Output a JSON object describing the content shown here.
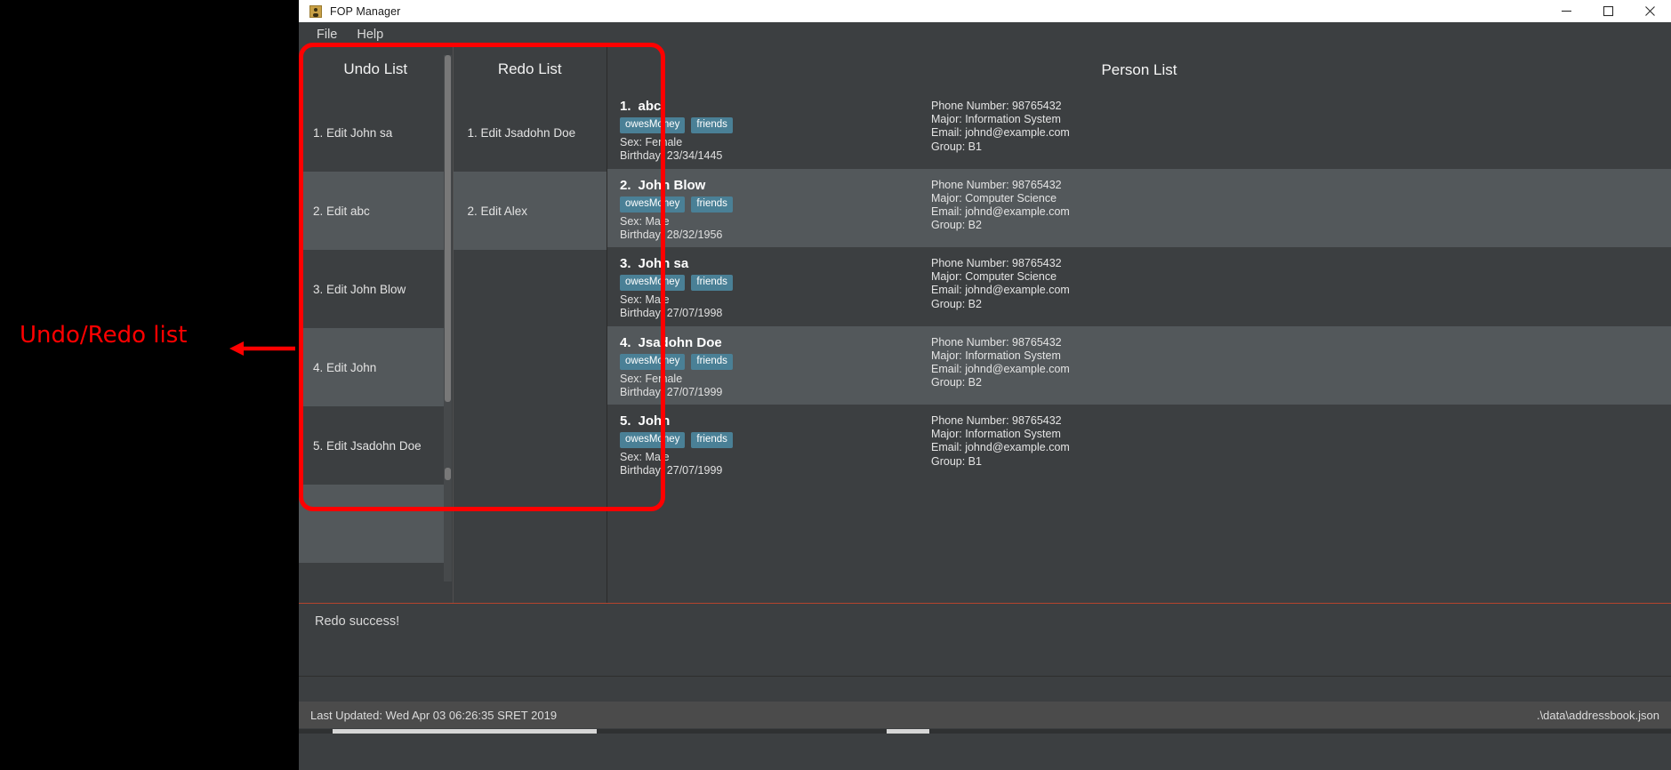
{
  "window": {
    "title": "FOP Manager",
    "icon": "app-person-icon",
    "controls": [
      {
        "name": "minimize",
        "glyph": "minimize-icon"
      },
      {
        "name": "maximize",
        "glyph": "maximize-icon"
      },
      {
        "name": "close",
        "glyph": "close-icon"
      }
    ]
  },
  "menubar": {
    "items": [
      {
        "label": "File"
      },
      {
        "label": "Help"
      }
    ]
  },
  "undo_list": {
    "title": "Undo List",
    "items": [
      {
        "label": "1. Edit John sa"
      },
      {
        "label": "2. Edit abc"
      },
      {
        "label": "3. Edit John Blow"
      },
      {
        "label": "4. Edit John"
      },
      {
        "label": "5. Edit Jsadohn Doe"
      },
      {
        "label": ""
      }
    ]
  },
  "redo_list": {
    "title": "Redo List",
    "items": [
      {
        "label": "1. Edit Jsadohn Doe"
      },
      {
        "label": "2. Edit Alex"
      }
    ]
  },
  "person_list": {
    "title": "Person List",
    "persons": [
      {
        "index": "1.",
        "name": "abc",
        "tags": [
          "owesMoney",
          "friends"
        ],
        "sex": "Sex: Female",
        "birthday": "Birthday: 23/34/1445",
        "phone": "Phone Number: 98765432",
        "major": "Major: Information System",
        "email": "Email: johnd@example.com",
        "group": "Group: B1"
      },
      {
        "index": "2.",
        "name": "John Blow",
        "tags": [
          "owesMoney",
          "friends"
        ],
        "sex": "Sex: Male",
        "birthday": "Birthday: 28/32/1956",
        "phone": "Phone Number: 98765432",
        "major": "Major: Computer Science",
        "email": "Email: johnd@example.com",
        "group": "Group: B2"
      },
      {
        "index": "3.",
        "name": "John sa",
        "tags": [
          "owesMoney",
          "friends"
        ],
        "sex": "Sex: Male",
        "birthday": "Birthday: 27/07/1998",
        "phone": "Phone Number: 98765432",
        "major": "Major: Computer Science",
        "email": "Email: johnd@example.com",
        "group": "Group: B2"
      },
      {
        "index": "4.",
        "name": "Jsadohn Doe",
        "tags": [
          "owesMoney",
          "friends"
        ],
        "sex": "Sex: Female",
        "birthday": "Birthday: 27/07/1999",
        "phone": "Phone Number: 98765432",
        "major": "Major: Information System",
        "email": "Email: johnd@example.com",
        "group": "Group: B2"
      },
      {
        "index": "5.",
        "name": "John",
        "tags": [
          "owesMoney",
          "friends"
        ],
        "sex": "Sex: Male",
        "birthday": "Birthday: 27/07/1999",
        "phone": "Phone Number: 98765432",
        "major": "Major: Information System",
        "email": "Email: johnd@example.com",
        "group": "Group: B1"
      }
    ]
  },
  "result_display": {
    "message": "Redo success!"
  },
  "statusbar": {
    "last_updated": "Last Updated: Wed Apr 03 06:26:35 SRET 2019",
    "save_location": ".\\data\\addressbook.json"
  },
  "annotation": {
    "label": "Undo/Redo list",
    "color": "#ff0000"
  },
  "colors": {
    "tag": "#4a8096",
    "panel": "#3c3f41",
    "row_alt": "#53585b",
    "status_bar": "#4b4b4b",
    "accent_rule": "#b4442d"
  }
}
